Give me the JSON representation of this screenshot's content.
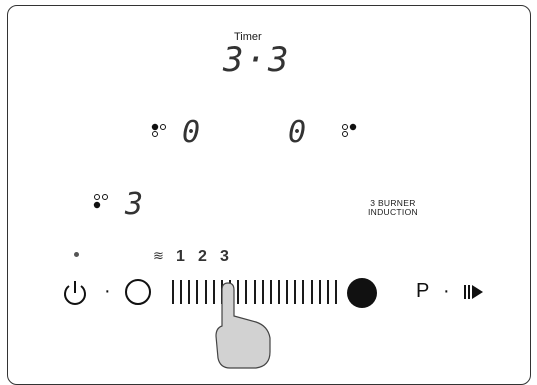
{
  "timer": {
    "label": "Timer",
    "value": "3·3"
  },
  "zones": {
    "top_left": {
      "value": "0"
    },
    "top_right": {
      "value": "0"
    },
    "bottom_left": {
      "value": "3"
    }
  },
  "brand": {
    "line1": "3 BURNER",
    "line2": "INDUCTION"
  },
  "power_levels": [
    "1",
    "2",
    "3"
  ],
  "controls": {
    "program_label": "P",
    "sep": "·"
  },
  "slider": {
    "ticks": 21,
    "active_level": 3
  },
  "icons": [
    "power-icon",
    "heat-waves-icon",
    "circle-ring-icon",
    "filled-knob-icon",
    "play-boost-icon",
    "hand-pointer-icon",
    "zone-position-icon"
  ]
}
